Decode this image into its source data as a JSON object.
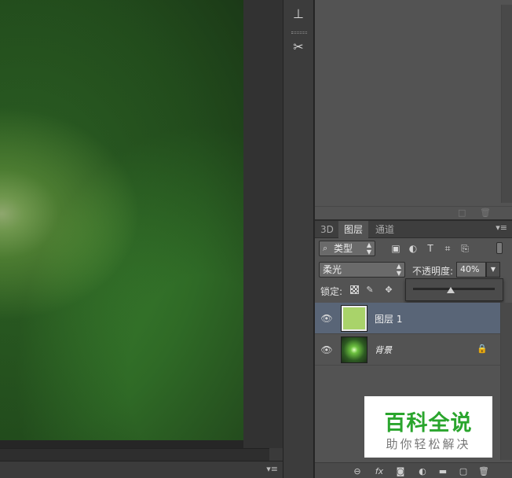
{
  "tools": [
    {
      "name": "stamp-tool-icon",
      "glyph": "⊥"
    },
    {
      "name": "brush-settings-icon",
      "glyph": "✂"
    }
  ],
  "canvas": {
    "bottom_menu_glyph": "▾≡"
  },
  "top_panel": {
    "footer_icons": [
      "□",
      "🗑"
    ]
  },
  "layers_panel": {
    "tabs": [
      {
        "label": "3D",
        "active": false
      },
      {
        "label": "图层",
        "active": true
      },
      {
        "label": "通道",
        "active": false
      }
    ],
    "menu_glyph": "▾≡",
    "filter": {
      "search_glyph": "⌕",
      "value": "类型",
      "icons": [
        "▣",
        "◐",
        "T",
        "⌗",
        "⎘"
      ]
    },
    "blend_mode": "柔光",
    "opacity_label": "不透明度:",
    "opacity_value": "40%",
    "opacity_slider_fraction": 0.4,
    "lock_label": "锁定:",
    "lock_icons": [
      "✎",
      "✥"
    ],
    "layers": [
      {
        "name": "图层 1",
        "selected": true,
        "locked": false
      },
      {
        "name": "背景",
        "selected": false,
        "locked": true
      }
    ],
    "footer_icons": [
      "⊖",
      "fx",
      "◙",
      "◐",
      "▬",
      "▢",
      "🗑"
    ]
  },
  "watermark": {
    "title": "百科全说",
    "subtitle": "助你轻松解决"
  },
  "colors": {
    "selected_layer": "#596577",
    "panel_bg": "#535353",
    "watermark_green": "#2aa52d"
  }
}
